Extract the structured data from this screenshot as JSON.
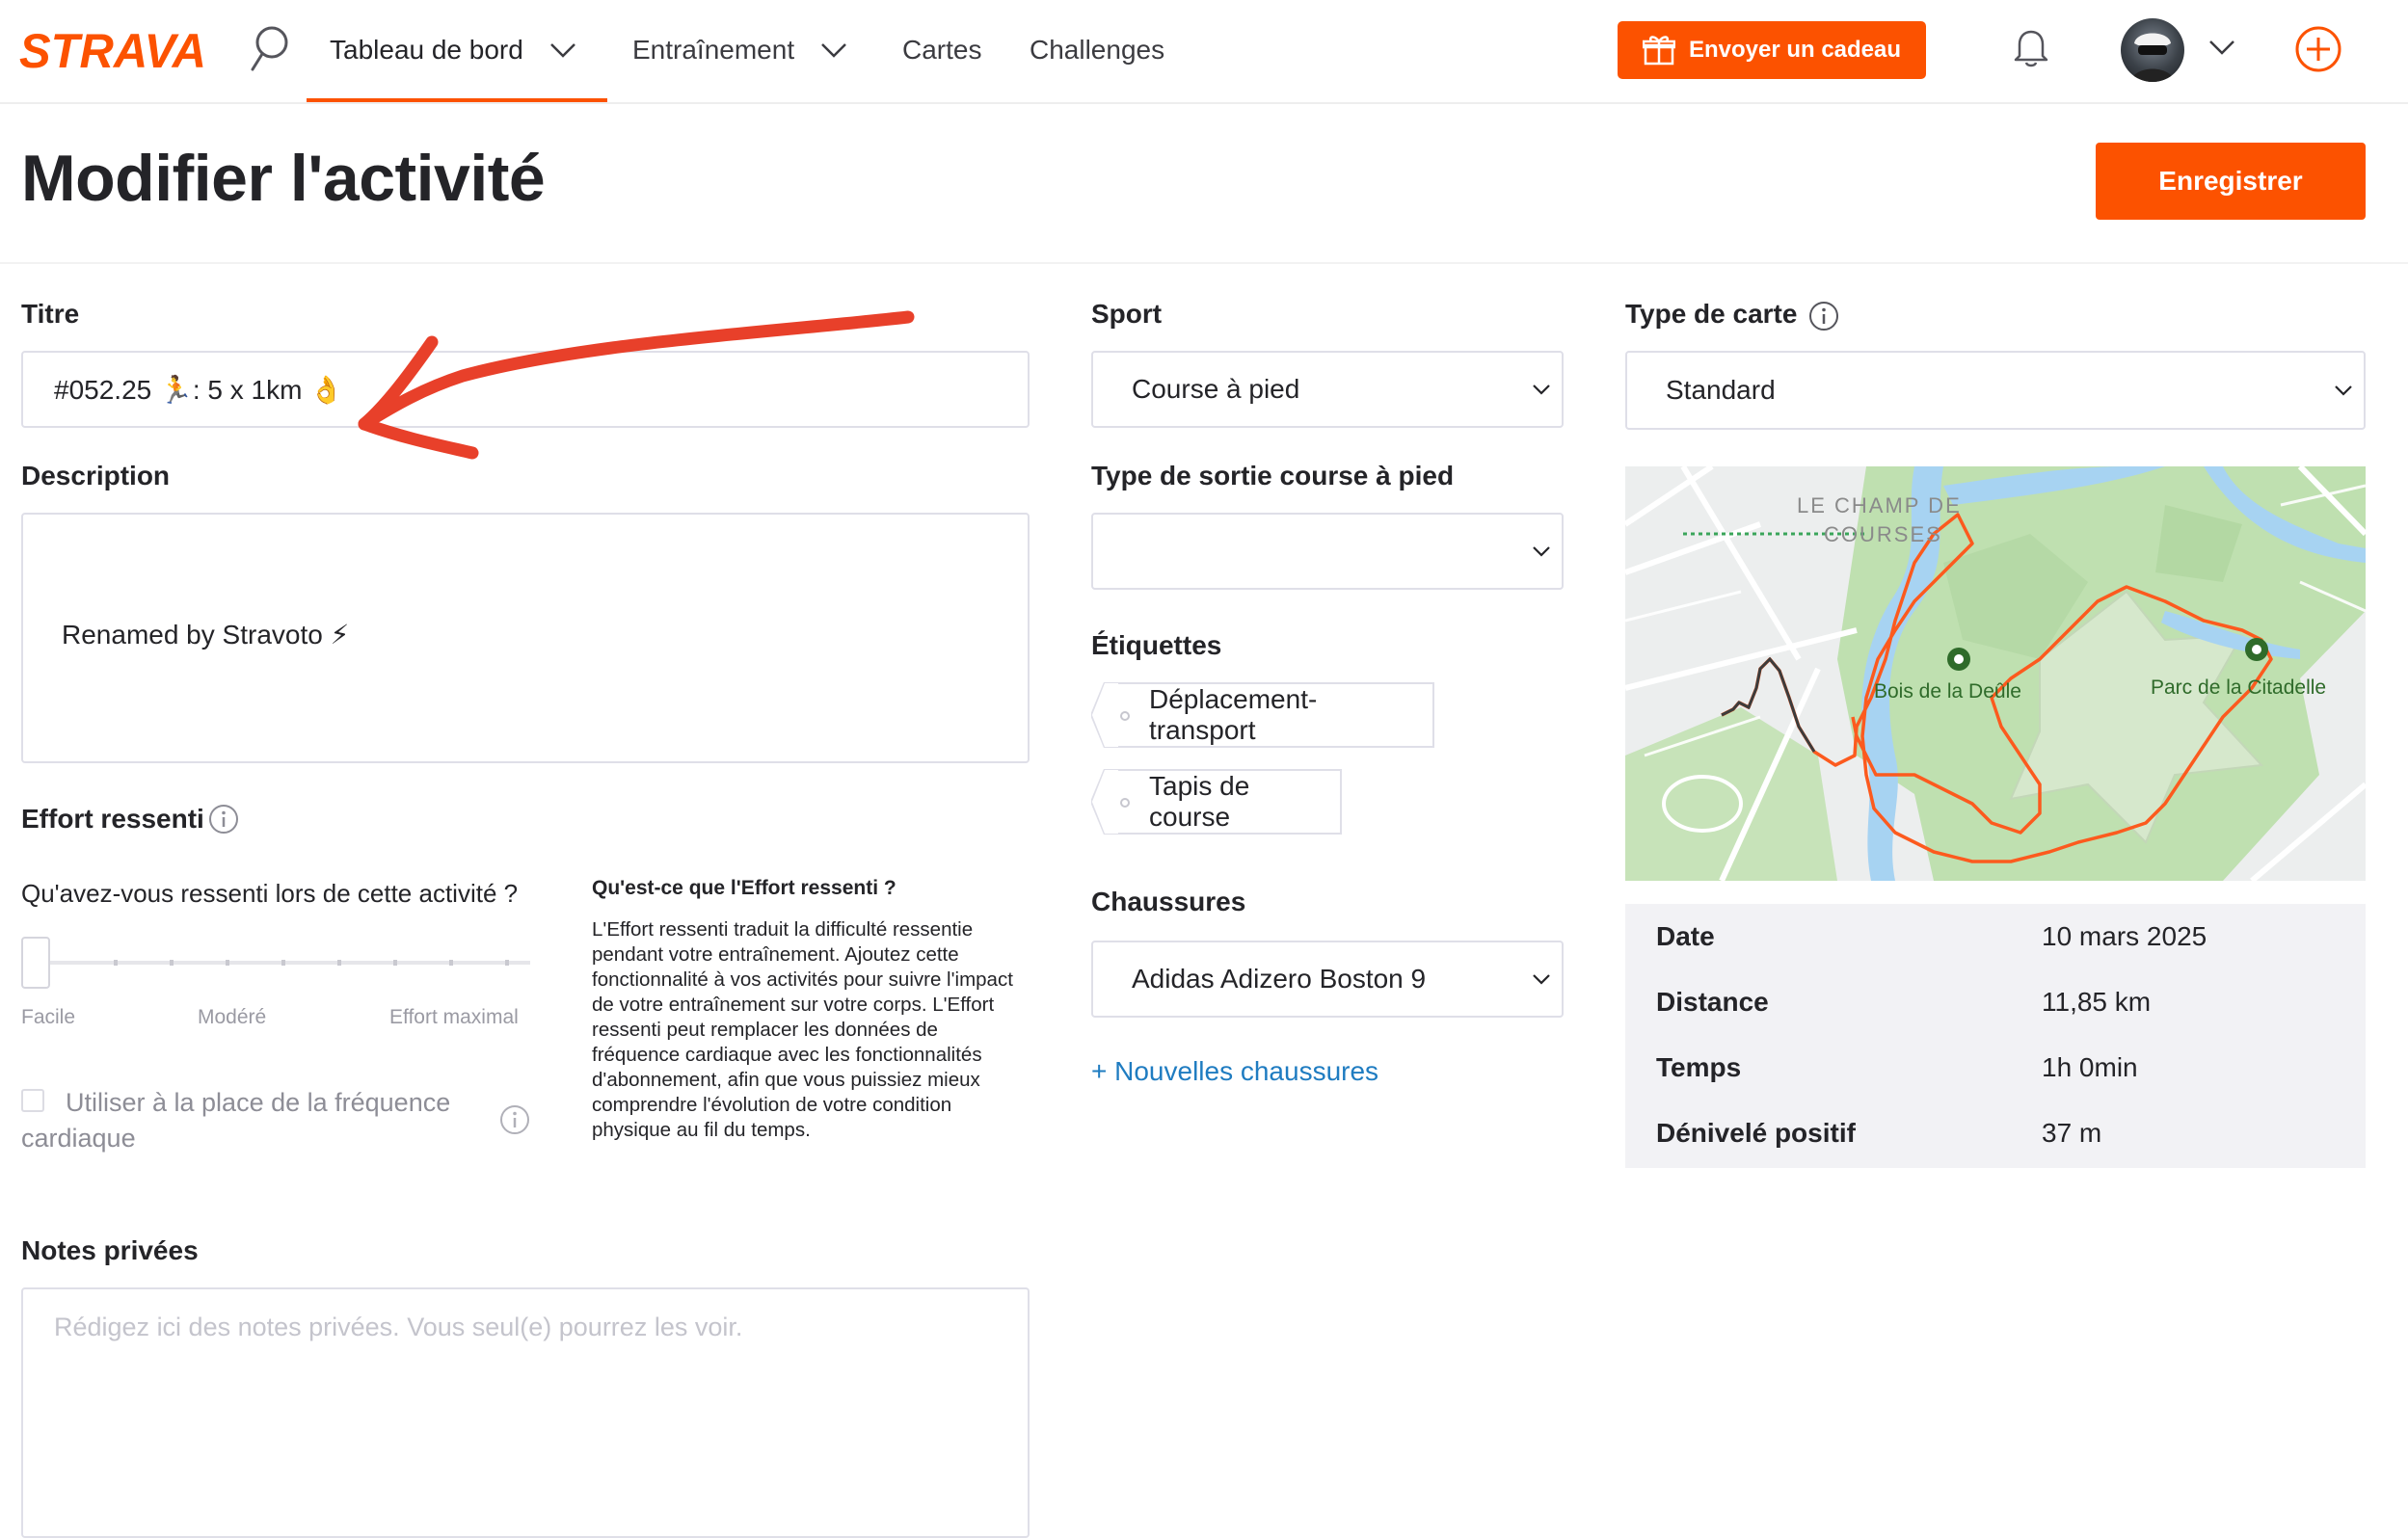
{
  "nav": {
    "logo": "STRAVA",
    "items": [
      {
        "label": "Tableau de bord",
        "has_dropdown": true,
        "active": true
      },
      {
        "label": "Entraînement",
        "has_dropdown": true,
        "active": false
      },
      {
        "label": "Cartes",
        "has_dropdown": false,
        "active": false
      },
      {
        "label": "Challenges",
        "has_dropdown": false,
        "active": false
      }
    ],
    "gift_button": "Envoyer un cadeau",
    "accent_color": "#fc5200"
  },
  "header": {
    "title": "Modifier l'activité",
    "save_button": "Enregistrer"
  },
  "form": {
    "title_label": "Titre",
    "title_value": "#052.25 🏃: 5 x 1km 👌",
    "description_label": "Description",
    "description_value": "Renamed by Stravoto ⚡",
    "effort": {
      "label": "Effort ressenti",
      "question": "Qu'avez-vous ressenti lors de cette activité ?",
      "scale": [
        "Facile",
        "Modéré",
        "Effort maximal"
      ],
      "slider_value": 0,
      "checkbox_label": "Utiliser à la place de la fréquence cardiaque",
      "checkbox_checked": false,
      "info_heading": "Qu'est-ce que l'Effort ressenti ?",
      "info_text": "L'Effort ressenti traduit la difficulté ressentie pendant votre entraînement. Ajoutez cette fonctionnalité à vos activités pour suivre l'impact de votre entraînement sur votre corps. L'Effort ressenti peut remplacer les données de fréquence cardiaque avec les fonctionnalités d'abonnement, afin que vous puissiez mieux comprendre l'évolution de votre condition physique au fil du temps."
    },
    "private_notes": {
      "label": "Notes privées",
      "placeholder": "Rédigez ici des notes privées. Vous seul(e) pourrez les voir."
    },
    "sport": {
      "label": "Sport",
      "value": "Course à pied"
    },
    "run_type": {
      "label": "Type de sortie course à pied",
      "value": ""
    },
    "tags": {
      "label": "Étiquettes",
      "items": [
        "Déplacement-transport",
        "Tapis de course"
      ]
    },
    "shoes": {
      "label": "Chaussures",
      "value": "Adidas Adizero Boston 9",
      "add_link": "+ Nouvelles chaussures"
    },
    "map_type": {
      "label": "Type de carte",
      "value": "Standard"
    }
  },
  "map": {
    "labels": [
      "LE CHAMP DE COURSES",
      "Bois de la Deûle",
      "Parc de la Citadelle"
    ]
  },
  "stats": [
    {
      "label": "Date",
      "value": "10 mars 2025"
    },
    {
      "label": "Distance",
      "value": "11,85 km"
    },
    {
      "label": "Temps",
      "value": "1h 0min"
    },
    {
      "label": "Dénivelé positif",
      "value": "37 m"
    }
  ]
}
